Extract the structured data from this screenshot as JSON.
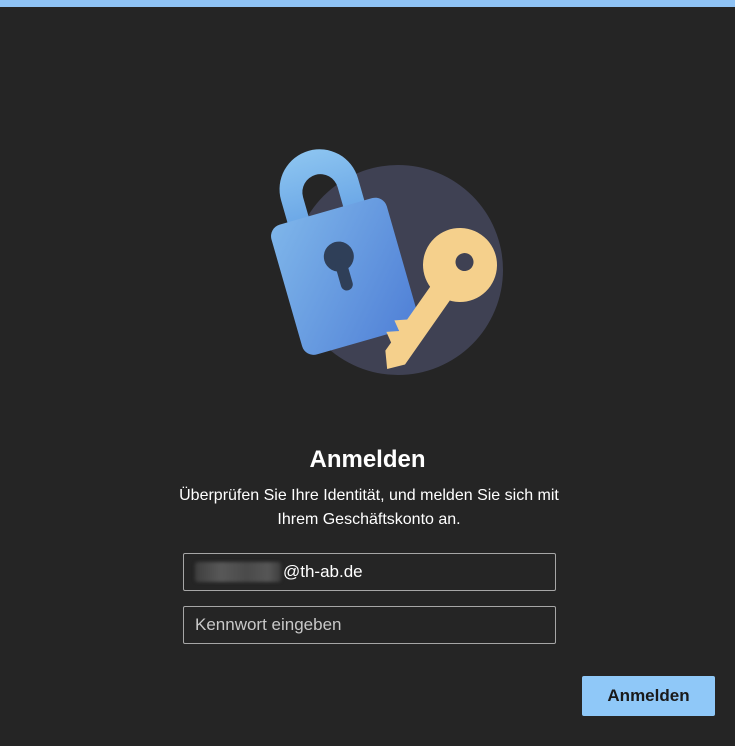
{
  "header": {
    "accent_color": "#8fc3f5"
  },
  "illustration": {
    "icon": "lock-and-key-icon"
  },
  "title": "Anmelden",
  "subtitle_line1": "Überprüfen Sie Ihre Identität, und melden Sie sich mit",
  "subtitle_line2": "Ihrem Geschäftskonto an.",
  "email": {
    "domain": "@th-ab.de"
  },
  "password": {
    "placeholder": "Kennwort eingeben"
  },
  "submit": {
    "label": "Anmelden",
    "color": "#8fc8f8"
  }
}
